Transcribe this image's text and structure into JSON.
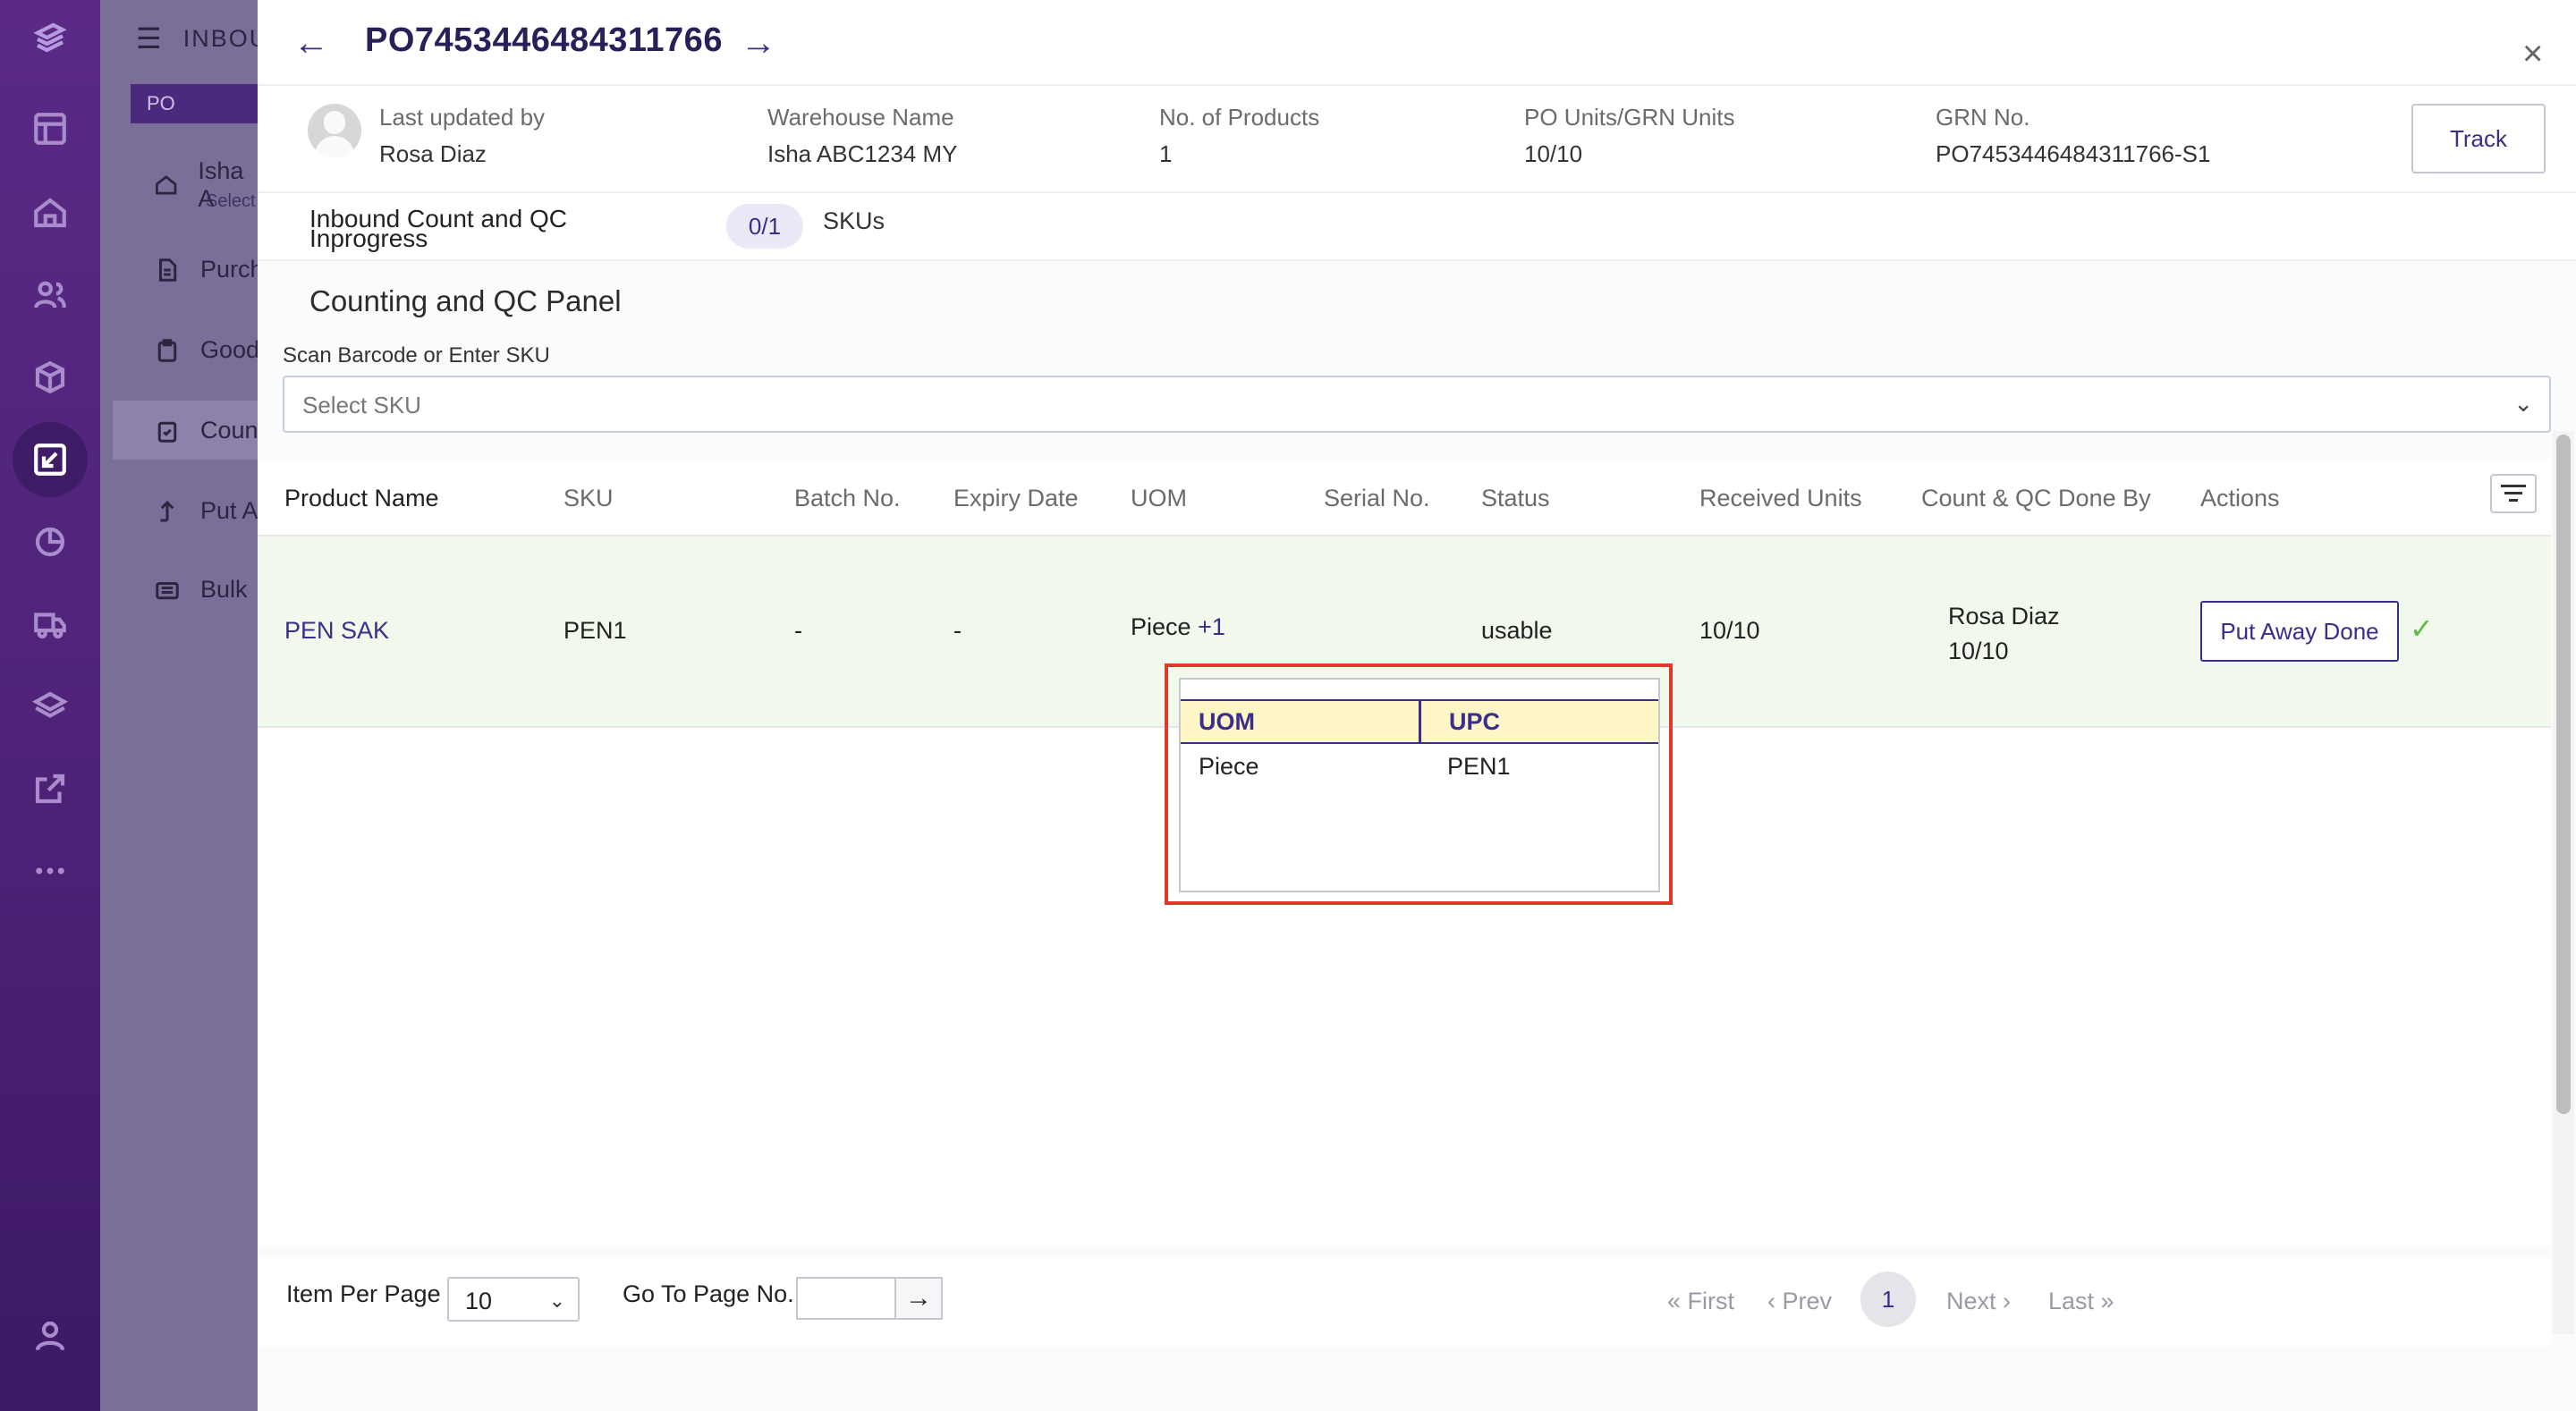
{
  "rail": {
    "icons": [
      "logo-icon",
      "layout-icon",
      "home-icon",
      "users-icon",
      "package-icon",
      "inbound-icon",
      "chart-icon",
      "truck-icon",
      "layers-icon",
      "external-link-icon",
      "more-icon",
      "user-icon"
    ],
    "active": "inbound-icon"
  },
  "sidebar": {
    "header": "INBOU",
    "po_tab": "PO",
    "items": [
      {
        "label": "Isha A",
        "icon": "home-icon"
      },
      {
        "label": "Purch",
        "icon": "document-icon"
      },
      {
        "label": "Good",
        "icon": "clipboard-icon"
      },
      {
        "label": "Coun",
        "icon": "clipboard-check-icon"
      },
      {
        "label": "Put A",
        "icon": "putaway-icon"
      },
      {
        "label": "Bulk",
        "icon": "list-icon"
      }
    ],
    "select_text": "Select"
  },
  "header": {
    "title": "PO7453446484311766",
    "back_label": "←",
    "forward_label": "→",
    "close_label": "×"
  },
  "info": {
    "last_updated_label": "Last updated by",
    "last_updated_value": "Rosa Diaz",
    "warehouse_label": "Warehouse Name",
    "warehouse_value": "Isha ABC1234 MY",
    "products_label": "No. of Products",
    "products_value": "1",
    "units_label": "PO Units/GRN Units",
    "units_value": "10/10",
    "grn_label": "GRN No.",
    "grn_value": "PO7453446484311766-S1",
    "track_label": "Track"
  },
  "progress": {
    "label": "Inbound Count and QC Inprogress",
    "count": "0/1",
    "unit": "SKUs"
  },
  "qc_panel": {
    "title": "Counting and QC Panel",
    "scan_label": "Scan Barcode or Enter SKU",
    "select_placeholder": "Select SKU"
  },
  "table": {
    "columns": [
      "Product Name",
      "SKU",
      "Batch No.",
      "Expiry Date",
      "UOM",
      "Serial No.",
      "Status",
      "Received Units",
      "Count & QC Done By",
      "Actions"
    ],
    "rows": [
      {
        "product_name": "PEN SAK",
        "sku": "PEN1",
        "batch": "-",
        "expiry": "-",
        "uom": "Piece",
        "uom_more": "+1",
        "serial": "",
        "status": "usable",
        "received": "10/10",
        "done_by_name": "Rosa Diaz",
        "done_by_units": "10/10",
        "action_label": "Put Away Done",
        "action_done_icon": "check-icon"
      }
    ]
  },
  "uom_popup": {
    "headers": [
      "UOM",
      "UPC"
    ],
    "rows": [
      [
        "Piece",
        "PEN1"
      ]
    ]
  },
  "footer": {
    "items_per_page_label": "Item Per Page",
    "items_per_page_value": "10",
    "goto_label": "Go To Page No.",
    "goto_value": "",
    "goto_button": "→",
    "first": "First",
    "prev": "Prev",
    "current_page": "1",
    "next": "Next",
    "last": "Last"
  }
}
